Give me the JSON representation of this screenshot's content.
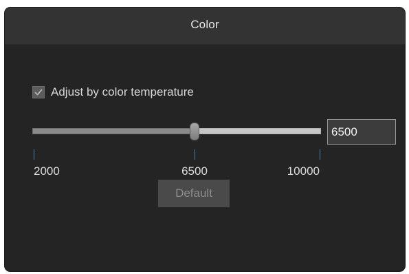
{
  "window": {
    "title": "Color"
  },
  "adjust_checkbox": {
    "label": "Adjust by color temperature",
    "checked": true
  },
  "temperature_slider": {
    "min": 2000,
    "max": 10000,
    "value": 6500,
    "ticks": [
      {
        "label": "2000",
        "value": 2000
      },
      {
        "label": "6500",
        "value": 6500
      },
      {
        "label": "10000",
        "value": 10000
      }
    ]
  },
  "temperature_input": {
    "value": "6500"
  },
  "default_button": {
    "label": "Default",
    "enabled": false
  },
  "colors": {
    "window_bg": "#242424",
    "titlebar_bg": "#333333",
    "tick_accent": "#4a7fb0"
  },
  "icons": {
    "checkbox_mark": "checkmark-icon"
  }
}
